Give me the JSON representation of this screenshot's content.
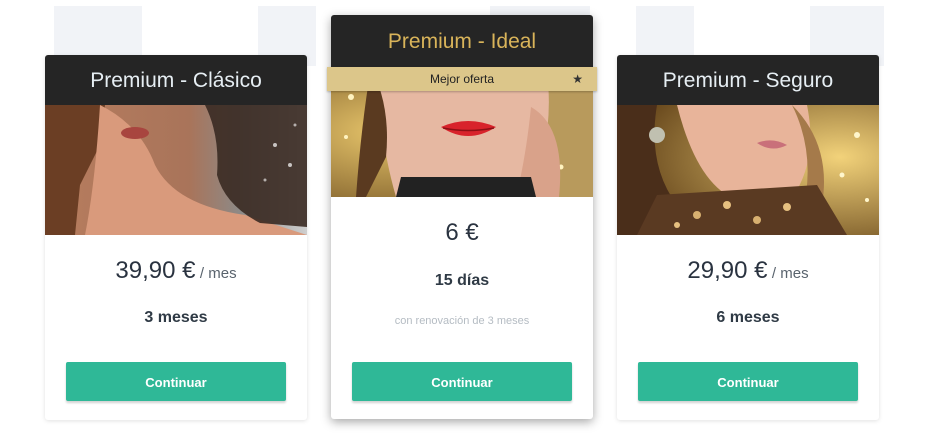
{
  "plans": [
    {
      "title": "Premium - Clásico",
      "price": "39,90 €",
      "unit": "/ mes",
      "duration": "3 meses",
      "button": "Continuar"
    },
    {
      "title": "Premium - Ideal",
      "badge": "Mejor oferta",
      "badge_icon": "star-icon",
      "price": "6 €",
      "duration": "15 días",
      "note": "con renovación de 3 meses",
      "button": "Continuar"
    },
    {
      "title": "Premium - Seguro",
      "price": "29,90 €",
      "unit": "/ mes",
      "duration": "6 meses",
      "button": "Continuar"
    }
  ],
  "colors": {
    "header_bg": "#252525",
    "featured_title": "#d9b45a",
    "badge_bg": "#dcc68a",
    "button_bg": "#2fb897"
  }
}
